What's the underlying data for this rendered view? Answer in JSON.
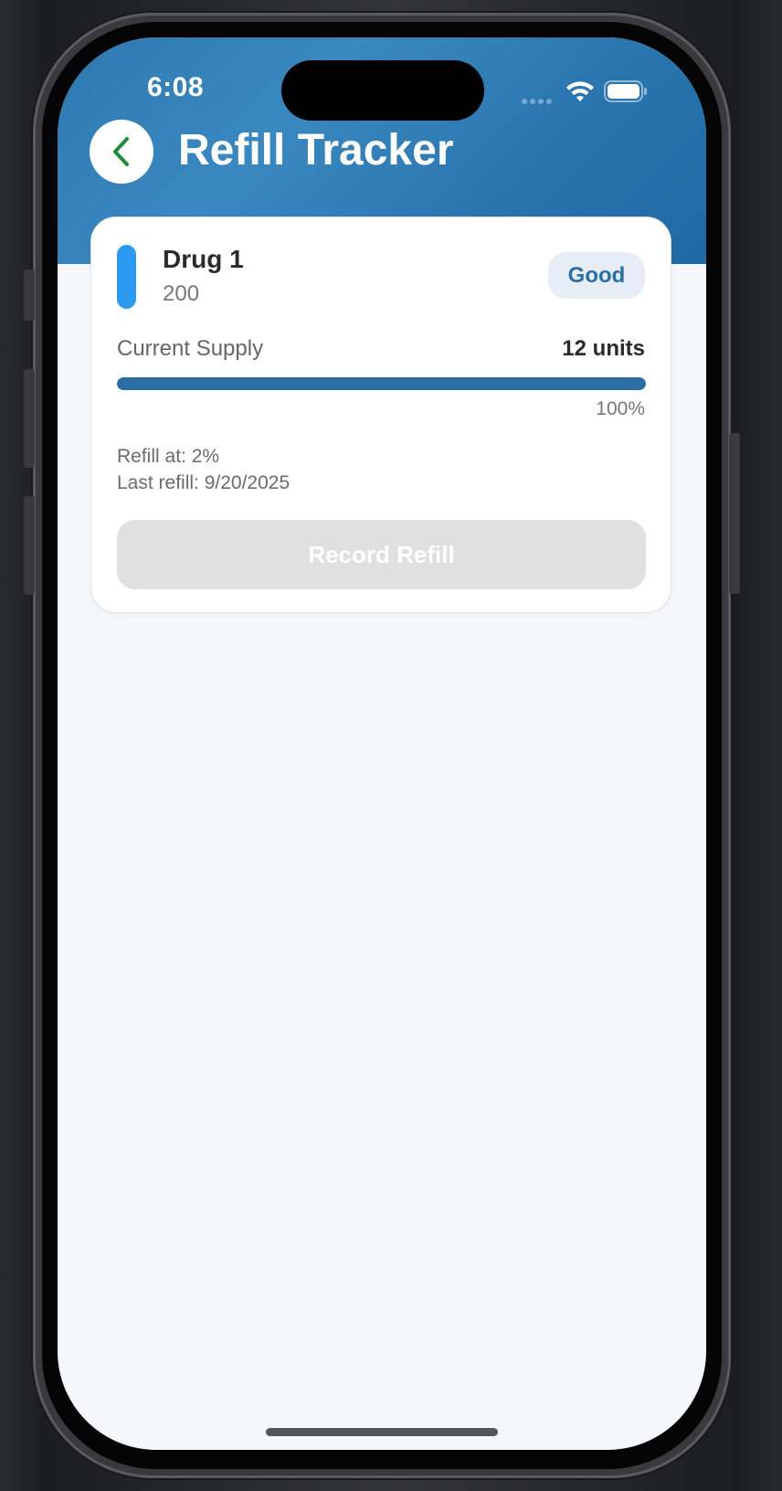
{
  "status_bar": {
    "time": "6:08",
    "icons": [
      "signal-icon",
      "wifi-icon",
      "battery-icon"
    ]
  },
  "header": {
    "title": "Refill Tracker",
    "back_icon": "chevron-left-icon"
  },
  "medication": {
    "name": "Drug 1",
    "dose": "200",
    "status": "Good",
    "supply_label": "Current Supply",
    "supply_value": "12 units",
    "supply_percent_text": "100%",
    "supply_fraction": 1.0,
    "refill_at": "Refill at: 2%",
    "last_refill": "Last refill: 9/20/2025",
    "record_button": "Record Refill"
  },
  "colors": {
    "header_blue": "#2a74ad",
    "accent_blue": "#2a6ea6",
    "drug_color": "#2b9af0",
    "back_chevron": "#1e8a3a",
    "disabled_button": "#e0e0e0"
  }
}
